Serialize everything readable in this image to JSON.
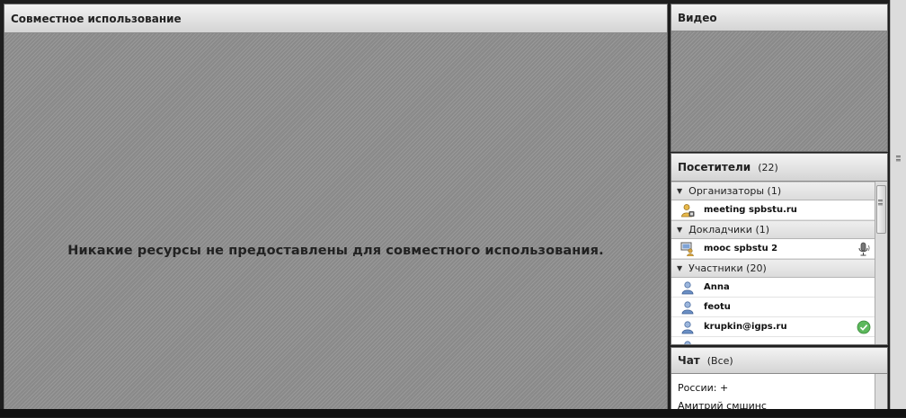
{
  "share_pod": {
    "title": "Совместное использование",
    "message": "Никакие ресурсы не предоставлены для совместного использования."
  },
  "video_pod": {
    "title": "Видео"
  },
  "attendees_pod": {
    "title": "Посетители",
    "count": "(22)",
    "groups": [
      {
        "label": "Организаторы (1)",
        "members": [
          {
            "name": "meeting spbstu.ru",
            "role_icon": "host-icon",
            "status_icon": ""
          }
        ]
      },
      {
        "label": "Докладчики (1)",
        "members": [
          {
            "name": "mooc spbstu 2",
            "role_icon": "presenter-icon",
            "status_icon": "microphone-icon"
          }
        ]
      },
      {
        "label": "Участники (20)",
        "members": [
          {
            "name": "Anna",
            "role_icon": "user-icon",
            "status_icon": ""
          },
          {
            "name": "feotu",
            "role_icon": "user-icon",
            "status_icon": ""
          },
          {
            "name": "krupkin@igps.ru",
            "role_icon": "user-icon",
            "status_icon": "agree-check-icon"
          }
        ]
      }
    ]
  },
  "chat_pod": {
    "title": "Чат",
    "filter": "(Все)",
    "messages": [
      {
        "text": "России: +"
      },
      {
        "text": "Амитрий смшинс"
      }
    ]
  },
  "colors": {
    "pod_background": "#9a9a9a",
    "header_gradient_top": "#f3f3f3",
    "header_gradient_bottom": "#d4d4d4",
    "agree_green": "#5cb85c",
    "user_icon_blue": "#6a8fc4"
  }
}
